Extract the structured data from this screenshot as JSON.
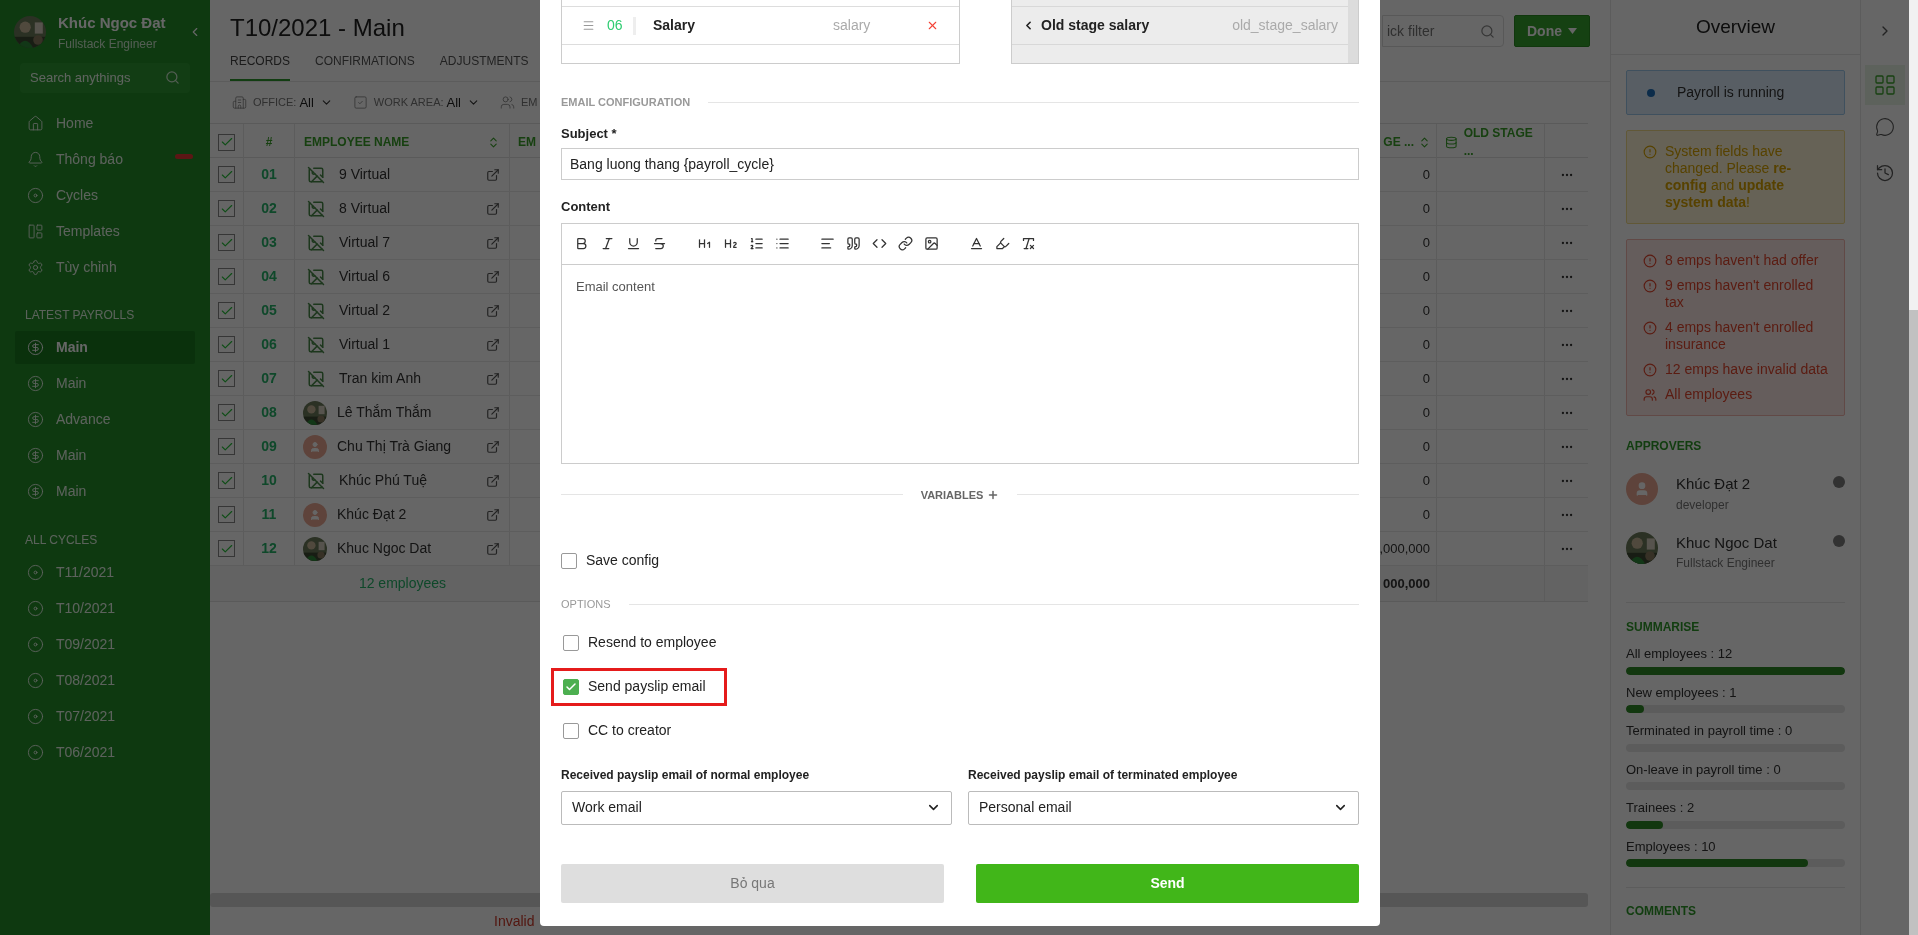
{
  "sidebar": {
    "user": {
      "name": "Khúc Ngọc Đạt",
      "role": "Fullstack Engineer"
    },
    "search": {
      "placeholder": "Search anythings"
    },
    "nav": [
      {
        "label": "Home",
        "alert": false
      },
      {
        "label": "Thông báo",
        "alert": true
      },
      {
        "label": "Cycles",
        "alert": false
      },
      {
        "label": "Templates",
        "alert": false
      },
      {
        "label": "Tùy chỉnh",
        "alert": false
      }
    ],
    "sections": [
      {
        "title": "LATEST PAYROLLS",
        "kind": "payroll",
        "items": [
          {
            "label": "Main",
            "selected": true
          },
          {
            "label": "Main",
            "selected": false
          },
          {
            "label": "Advance",
            "selected": false
          },
          {
            "label": "Main",
            "selected": false
          },
          {
            "label": "Main",
            "selected": false
          }
        ]
      },
      {
        "title": "ALL CYCLES",
        "kind": "cycle",
        "items": [
          {
            "label": "T11/2021",
            "selected": false
          },
          {
            "label": "T10/2021",
            "selected": false
          },
          {
            "label": "T09/2021",
            "selected": false
          },
          {
            "label": "T08/2021",
            "selected": false
          },
          {
            "label": "T07/2021",
            "selected": false
          },
          {
            "label": "T06/2021",
            "selected": false
          }
        ]
      }
    ]
  },
  "main": {
    "title": "T10/2021 - Main",
    "tabs": [
      {
        "label": "RECORDS",
        "selected": true
      },
      {
        "label": "CONFIRMATIONS",
        "selected": false
      },
      {
        "label": "ADJUSTMENTS",
        "selected": false
      }
    ],
    "quick_filter": {
      "placeholder": "ick filter"
    },
    "done_button": "Done",
    "filters": [
      {
        "label": "OFFICE:",
        "value": "All"
      },
      {
        "label": "WORK AREA:",
        "value": "All"
      },
      {
        "label": "EM"
      }
    ],
    "table": {
      "all_checked": true,
      "columns": [
        {
          "label": "#"
        },
        {
          "label": "EMPLOYEE NAME",
          "sortable": true
        },
        {
          "label": "EM",
          "sortable": false
        },
        {
          "label": "GE ...",
          "sortable": true
        },
        {
          "label": "OLD STAGE ..."
        }
      ],
      "rows": [
        {
          "checked": true,
          "number": "01",
          "name": "9 Virtual",
          "avatar": {
            "kind": "broken"
          },
          "value": "0"
        },
        {
          "checked": true,
          "number": "02",
          "name": "8 Virtual",
          "avatar": {
            "kind": "broken"
          },
          "value": "0"
        },
        {
          "checked": true,
          "number": "03",
          "name": "Virtual 7",
          "avatar": {
            "kind": "broken"
          },
          "value": "0"
        },
        {
          "checked": true,
          "number": "04",
          "name": "Virtual 6",
          "avatar": {
            "kind": "broken"
          },
          "value": "0"
        },
        {
          "checked": true,
          "number": "05",
          "name": "Virtual 2",
          "avatar": {
            "kind": "broken"
          },
          "value": "0"
        },
        {
          "checked": true,
          "number": "06",
          "name": "Virtual 1",
          "avatar": {
            "kind": "broken"
          },
          "value": "0"
        },
        {
          "checked": true,
          "number": "07",
          "name": "Tran kim Anh",
          "avatar": {
            "kind": "broken"
          },
          "value": "0"
        },
        {
          "checked": true,
          "number": "08",
          "name": "Lê Thắm Thắm",
          "value": "0"
        },
        {
          "checked": true,
          "number": "09",
          "name": "Chu Thị Trà Giang",
          "avatar": {
            "kind": "placeholder"
          },
          "value": "0"
        },
        {
          "checked": true,
          "number": "10",
          "name": "Khúc Phú Tuệ",
          "avatar": {
            "kind": "broken"
          },
          "value": "0"
        },
        {
          "checked": true,
          "number": "11",
          "name": "Khúc Đạt 2",
          "avatar": {
            "kind": "placeholder"
          },
          "value": "0"
        },
        {
          "checked": true,
          "number": "12",
          "name": "Khuc Ngoc Dat",
          "value": ",000,000"
        }
      ],
      "footer": {
        "count": "12 employees",
        "total": "000,000"
      }
    },
    "bottom_note": "Invalid"
  },
  "modal": {
    "fields": [
      {
        "number": "06",
        "name": "Salary",
        "key": "salary"
      }
    ],
    "stage_fields": [
      {
        "name": "Old stage salary",
        "key": "old_stage_salary"
      }
    ],
    "email_title": "EMAIL CONFIGURATION",
    "subject": {
      "label": "Subject *",
      "value": "Bang luong thang {payroll_cycle}"
    },
    "content": {
      "label": "Content",
      "placeholder": "Email content"
    },
    "variables": "VARIABLES",
    "save_config": {
      "label": "Save config",
      "checked": false
    },
    "options_title": "OPTIONS",
    "options": [
      {
        "label": "Resend to employee",
        "checked": false,
        "highlighted": false
      },
      {
        "label": "Send payslip email",
        "checked": true,
        "highlighted": true
      },
      {
        "label": "CC to creator",
        "checked": false,
        "highlighted": false
      }
    ],
    "selects": [
      {
        "label": "Received payslip email of normal employee",
        "value": "Work email"
      },
      {
        "label": "Received payslip email of terminated employee",
        "value": "Personal email"
      }
    ],
    "cancel_button": "Bỏ qua",
    "send_button": "Send"
  },
  "overview": {
    "title": "Overview",
    "status": "Payroll is running",
    "warning": "System fields have changed. Please **re-config** and **update system data**!",
    "issues": [
      {
        "kind": "alert",
        "text": "8 emps haven't had offer"
      },
      {
        "kind": "alert",
        "text": "9 emps haven't enrolled tax"
      },
      {
        "kind": "alert",
        "text": "4 emps haven't enrolled insurance"
      },
      {
        "kind": "alert",
        "text": "12 emps have invalid data"
      },
      {
        "kind": "people",
        "text": "All employees"
      }
    ],
    "approvers_title": "APPROVERS",
    "approvers": [
      {
        "name": "Khúc Đạt 2",
        "role": "developer",
        "avatar": {
          "kind": "placeholder"
        }
      },
      {
        "name": "Khuc Ngoc Dat",
        "role": "Fullstack Engineer"
      }
    ],
    "summary_title": "SUMMARISE",
    "summary": [
      {
        "label": "All employees : 12",
        "level": 1
      },
      {
        "label": "New employees : 1",
        "level": 0.083
      },
      {
        "label": "Terminated in payroll time : 0",
        "level": 0
      },
      {
        "label": "On-leave in payroll time : 0",
        "level": 0
      },
      {
        "label": "Trainees : 2",
        "level": 0.167
      },
      {
        "label": "Employees : 10",
        "level": 0.833
      }
    ],
    "comments_title": "COMMENTS"
  }
}
